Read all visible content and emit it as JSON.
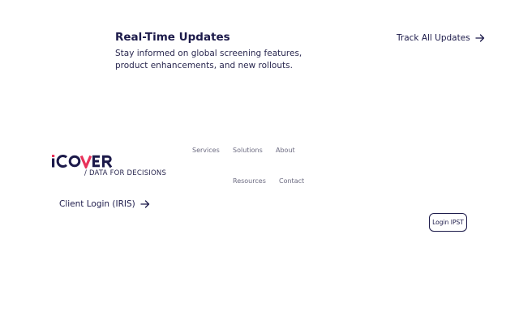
{
  "updates": {
    "title": "Real-Time Updates",
    "description": "Stay informed on global screening features, product enhancements, and new rollouts.",
    "track_link": "Track All Updates"
  },
  "logo": {
    "text": "iCOVER",
    "tagline": "/ DATA FOR DECISIONS",
    "colors": {
      "dark": "#1c1a4a",
      "accent": "#e8325a"
    }
  },
  "footer_nav": {
    "services": "Services",
    "solutions": "Solutions",
    "about": "About",
    "resources": "Resources",
    "contact": "Contact"
  },
  "client_login": "Client Login (IRIS)",
  "login_button": "Login IPST",
  "icons": {
    "arrow": "arrow-right-icon"
  },
  "colors": {
    "text": "#1c1a4a",
    "muted": "#6b6a80",
    "background": "#ffffff"
  }
}
